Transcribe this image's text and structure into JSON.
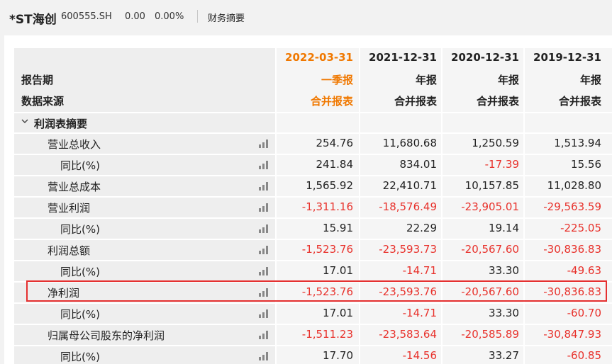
{
  "header": {
    "stock_name": "*ST海创",
    "stock_code": "600555.SH",
    "price": "0.00",
    "change_pct": "0.00%",
    "report_link": "财务摘要"
  },
  "table": {
    "period_label": "报告期",
    "source_label": "数据来源",
    "columns": [
      {
        "date": "2022-03-31",
        "period": "一季报",
        "source": "合并报表",
        "highlighted": true
      },
      {
        "date": "2021-12-31",
        "period": "年报",
        "source": "合并报表"
      },
      {
        "date": "2020-12-31",
        "period": "年报",
        "source": "合并报表"
      },
      {
        "date": "2019-12-31",
        "period": "年报",
        "source": "合并报表"
      }
    ],
    "section_title": "利润表摘要",
    "rows": [
      {
        "label": "营业总收入",
        "indent": 1,
        "values": [
          "254.76",
          "11,680.68",
          "1,250.59",
          "1,513.94"
        ]
      },
      {
        "label": "同比(%)",
        "indent": 2,
        "values": [
          "241.84",
          "834.01",
          "-17.39",
          "15.56"
        ]
      },
      {
        "label": "营业总成本",
        "indent": 1,
        "values": [
          "1,565.92",
          "22,410.71",
          "10,157.85",
          "11,028.80"
        ]
      },
      {
        "label": "营业利润",
        "indent": 1,
        "values": [
          "-1,311.16",
          "-18,576.49",
          "-23,905.01",
          "-29,563.59"
        ]
      },
      {
        "label": "同比(%)",
        "indent": 2,
        "values": [
          "15.91",
          "22.29",
          "19.14",
          "-225.05"
        ]
      },
      {
        "label": "利润总额",
        "indent": 1,
        "values": [
          "-1,523.76",
          "-23,593.73",
          "-20,567.60",
          "-30,836.83"
        ]
      },
      {
        "label": "同比(%)",
        "indent": 2,
        "values": [
          "17.01",
          "-14.71",
          "33.30",
          "-49.63"
        ]
      },
      {
        "label": "净利润",
        "indent": 0,
        "values": [
          "-1,523.76",
          "-23,593.76",
          "-20,567.60",
          "-30,836.83"
        ]
      },
      {
        "label": "同比(%)",
        "indent": 2,
        "values": [
          "17.01",
          "-14.71",
          "33.30",
          "-60.70"
        ]
      },
      {
        "label": "归属母公司股东的净利润",
        "indent": 1,
        "values": [
          "-1,511.23",
          "-23,583.64",
          "-20,585.89",
          "-30,847.93"
        ]
      },
      {
        "label": "同比(%)",
        "indent": 2,
        "values": [
          "17.70",
          "-14.56",
          "33.27",
          "-60.85"
        ]
      }
    ]
  },
  "colors": {
    "highlight_column": "#f07800",
    "negative": "#e8312b",
    "highlight_box": "#e53030"
  },
  "icons": {
    "row_chart": "bar-chart-icon",
    "section_toggle": "chevron-down-icon"
  }
}
